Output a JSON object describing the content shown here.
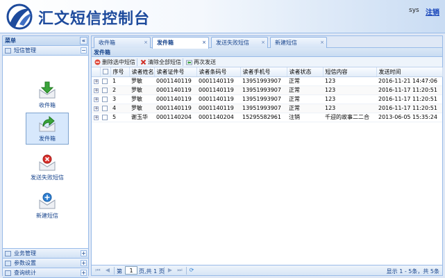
{
  "header": {
    "title": "汇文短信控制台",
    "user": "sys",
    "logout": "注销"
  },
  "sidebar": {
    "title": "菜单",
    "collapse_glyph": "«",
    "expanded_group": {
      "label": "短信管理",
      "toggle": "−"
    },
    "items": [
      {
        "label": "收件箱",
        "icon": "inbox-download-icon"
      },
      {
        "label": "发件箱",
        "icon": "outbox-send-icon",
        "selected": true
      },
      {
        "label": "发送失败短信",
        "icon": "failed-message-icon"
      },
      {
        "label": "新建短信",
        "icon": "new-message-icon"
      }
    ],
    "groups": [
      {
        "label": "业务管理",
        "toggle": "+"
      },
      {
        "label": "参数设置",
        "toggle": "+"
      },
      {
        "label": "查询统计",
        "toggle": "+"
      }
    ]
  },
  "tabs": [
    {
      "label": "收件箱",
      "close": "×"
    },
    {
      "label": "发件箱",
      "close": "×",
      "active": true
    },
    {
      "label": "发送失败短信",
      "close": "×"
    },
    {
      "label": "新建短信",
      "close": "×"
    }
  ],
  "panel_title": "发件箱",
  "toolbar": {
    "delete_selected": "删除选中短信",
    "clear_all": "清除全部短信",
    "resend": "再次发送"
  },
  "grid": {
    "columns": [
      "序号",
      "读者姓名",
      "读者证件号",
      "读者条码号",
      "读者手机号",
      "读者状态",
      "短信内容",
      "发送时间"
    ],
    "rows": [
      [
        "1",
        "罗敏",
        "0001140119",
        "0001140119",
        "13951993907",
        "正常",
        "123",
        "2016-11-21 14:47:06"
      ],
      [
        "2",
        "罗敏",
        "0001140119",
        "0001140119",
        "13951993907",
        "正常",
        "123",
        "2016-11-17 11:20:51"
      ],
      [
        "3",
        "罗敏",
        "0001140119",
        "0001140119",
        "13951993907",
        "正常",
        "123",
        "2016-11-17 11:20:51"
      ],
      [
        "4",
        "罗敏",
        "0001140119",
        "0001140119",
        "13951993907",
        "正常",
        "123",
        "2016-11-17 11:20:51"
      ],
      [
        "5",
        "谢玉华",
        "0001140204",
        "0001140204",
        "15295582961",
        "注销",
        "千迎的故事二二合",
        "2013-06-05 15:35:24"
      ]
    ]
  },
  "pager": {
    "page_prefix": "第",
    "page_value": "1",
    "page_suffix": "页,共 1 页",
    "summary": "显示 1 - 5条，共 5条"
  },
  "colors": {
    "brand": "#1d4a9c",
    "border": "#99bbe8",
    "selected": "#d7e8fc"
  }
}
